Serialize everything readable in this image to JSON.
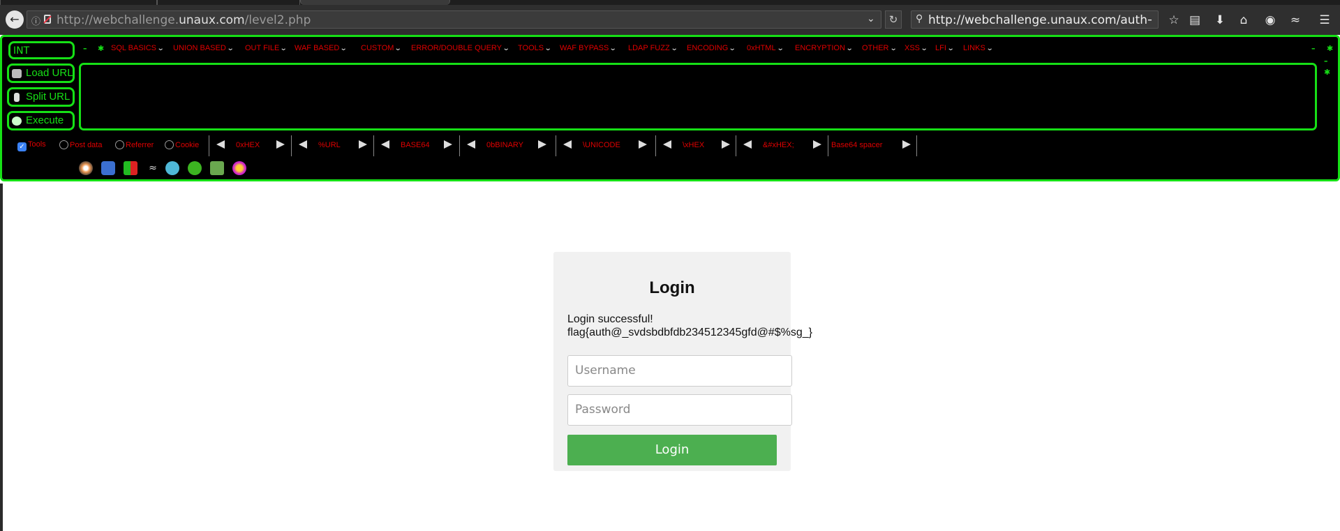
{
  "browser": {
    "url_prefix": "http://webchallenge.",
    "url_host": "unaux.com",
    "url_path": "/level2.php",
    "search_value": "http://webchallenge.unaux.com/auth",
    "search_arrow": "→"
  },
  "hackbar": {
    "int_value": "INT",
    "load_url": "Load URL",
    "split_url": "Split URL",
    "execute": "Execute",
    "menus": [
      "SQL BASICS",
      "UNION BASED",
      "OUT FILE",
      "WAF BASED",
      "CUSTOM",
      "ERROR/DOUBLE QUERY",
      "TOOLS",
      "WAF BYPASS",
      "LDAP FUZZ",
      "ENCODING",
      "0xHTML",
      "ENCRYPTION",
      "OTHER",
      "XSS",
      "LFI",
      "LINKS"
    ],
    "checkboxes": [
      {
        "label": "Tools",
        "checked": true
      },
      {
        "label": "Post data",
        "checked": false
      },
      {
        "label": "Referrer",
        "checked": false
      },
      {
        "label": "Cookie",
        "checked": false
      }
    ],
    "encoders": [
      "0xHEX",
      "%URL",
      "BASE64",
      "0bBINARY",
      "\\UNICODE",
      "\\xHEX",
      "&#xHEX;",
      "Base64 spacer"
    ]
  },
  "page": {
    "title": "Login",
    "message_line1": "Login successful!",
    "message_line2": "flag{auth@_svdsbdbfdb234512345gfd@#$%sg_}",
    "username_placeholder": "Username",
    "password_placeholder": "Password",
    "login_button": "Login"
  },
  "colors": {
    "hackbar_green": "#16e016",
    "hackbar_red": "#e00000",
    "login_button": "#4caf50"
  }
}
